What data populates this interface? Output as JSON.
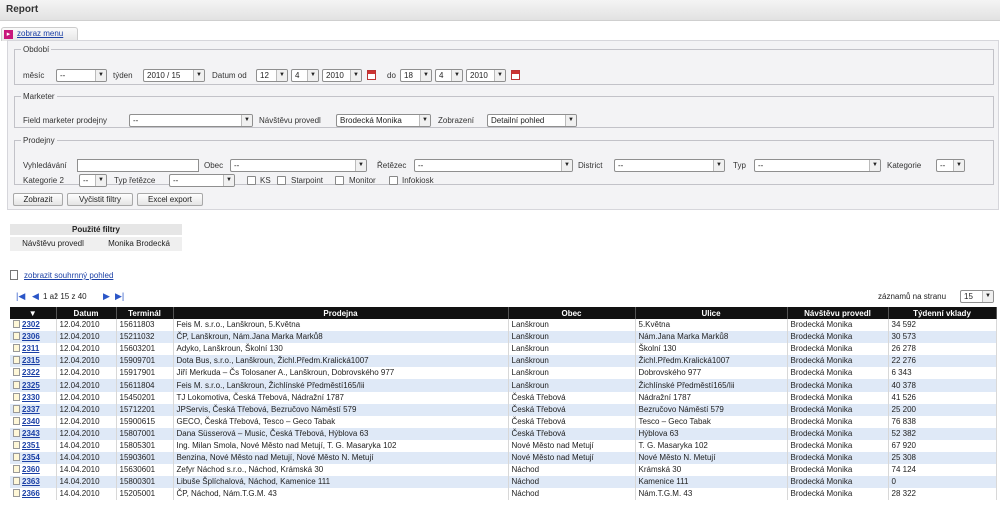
{
  "window": {
    "title": "Report"
  },
  "menu": {
    "toggle_label": "zobraz menu"
  },
  "obdobi": {
    "legend": "Období",
    "mesic_label": "měsíc",
    "mesic_value": "--",
    "tyden_label": "týden",
    "tyden_value": "2010 / 15",
    "datum_od_label": "Datum od",
    "od_day": "12",
    "od_month": "4",
    "od_year": "2010",
    "do_label": "do",
    "do_day": "18",
    "do_month": "4",
    "do_year": "2010"
  },
  "marketer": {
    "legend": "Marketer",
    "field_marketer_label": "Field marketer prodejny",
    "field_marketer_value": "--",
    "navstevu_label": "Návštěvu provedl",
    "navstevu_value": "Brodecká Monika",
    "zobrazeni_label": "Zobrazení",
    "zobrazeni_value": "Detailní pohled"
  },
  "prodejny": {
    "legend": "Prodejny",
    "vyhledavani_label": "Vyhledávání",
    "vyhledavani_value": "",
    "obec_label": "Obec",
    "obec_value": "--",
    "retezec_label": "Řetězec",
    "retezec_value": "--",
    "district_label": "District",
    "district_value": "--",
    "typ_label": "Typ",
    "typ_value": "--",
    "kategorie_label": "Kategorie",
    "kategorie_value": "--",
    "kategorie2_label": "Kategorie 2",
    "kategorie2_value": "--",
    "typ_retezce_label": "Typ řetězce",
    "typ_retezce_value": "--",
    "checkboxes": [
      "KS",
      "Starpoint",
      "Monitor",
      "Infokiosk"
    ]
  },
  "buttons": {
    "zobrazit": "Zobrazit",
    "vycistit": "Vyčistit filtry",
    "excel": "Excel export"
  },
  "used_filters": {
    "title": "Použité filtry",
    "key": "Návštěvu provedl",
    "value": "Monika Brodecká"
  },
  "summary_link": "zobrazit souhrnný pohled",
  "pager": {
    "text": "1 až 15 z 40",
    "per_page_label": "záznamů na stranu",
    "per_page_value": "15"
  },
  "table": {
    "headers": [
      "▼",
      "Datum",
      "Terminál",
      "Prodejna",
      "Obec",
      "Ulice",
      "Návštěvu provedl",
      "Týdenní vklady"
    ],
    "rows": [
      [
        "2302",
        "12.04.2010",
        "15611803",
        "Feis M. s.r.o., Lanškroun, 5.Května",
        "Lanškroun",
        "5.Května",
        "Brodecká Monika",
        "34 592"
      ],
      [
        "2306",
        "12.04.2010",
        "15211032",
        "ČP, Lanškroun, Nám.Jana Marka Marků8",
        "Lanškroun",
        "Nám.Jana Marka Marků8",
        "Brodecká Monika",
        "30 573"
      ],
      [
        "2311",
        "12.04.2010",
        "15603201",
        "Adyko, Lanškroun, Školní 130",
        "Lanškroun",
        "Školní 130",
        "Brodecká Monika",
        "26 278"
      ],
      [
        "2315",
        "12.04.2010",
        "15909701",
        "Dota Bus, s.r.o., Lanškroun, Žichl.Předm.Kralická1007",
        "Lanškroun",
        "Žichl.Předm.Kralická1007",
        "Brodecká Monika",
        "22 276"
      ],
      [
        "2322",
        "12.04.2010",
        "15917901",
        "Jiří Merkuda – Čs Tolosaner A., Lanškroun, Dobrovského 977",
        "Lanškroun",
        "Dobrovského 977",
        "Brodecká Monika",
        "6 343"
      ],
      [
        "2325",
        "12.04.2010",
        "15611804",
        "Feis M. s.r.o., Lanškroun, Žichlínské Předměstí165/Iii",
        "Lanškroun",
        "Žichlínské Předměstí165/Iii",
        "Brodecká Monika",
        "40 378"
      ],
      [
        "2330",
        "12.04.2010",
        "15450201",
        "TJ Lokomotiva, Česká Třebová, Nádražní 1787",
        "Česká Třebová",
        "Nádražní 1787",
        "Brodecká Monika",
        "41 526"
      ],
      [
        "2337",
        "12.04.2010",
        "15712201",
        "JPServis, Česká Třebová, Bezručovo Náměstí 579",
        "Česká Třebová",
        "Bezručovo Náměstí 579",
        "Brodecká Monika",
        "25 200"
      ],
      [
        "2340",
        "12.04.2010",
        "15900615",
        "GECO, Česká Třebová, Tesco – Geco Tabak",
        "Česká Třebová",
        "Tesco – Geco Tabak",
        "Brodecká Monika",
        "76 838"
      ],
      [
        "2343",
        "12.04.2010",
        "15807001",
        "Dana Süsserová – Music, Česká Třebová, Hýblova 63",
        "Česká Třebová",
        "Hýblova 63",
        "Brodecká Monika",
        "52 382"
      ],
      [
        "2351",
        "14.04.2010",
        "15805301",
        "Ing. Milan Smola, Nové Město nad Metují, T. G. Masaryka 102",
        "Nové Město nad Metují",
        "T. G. Masaryka 102",
        "Brodecká Monika",
        "67 920"
      ],
      [
        "2354",
        "14.04.2010",
        "15903601",
        "Benzina, Nové Město nad Metují, Nové Město N. Metují",
        "Nové Město nad Metují",
        "Nové Město N. Metují",
        "Brodecká Monika",
        "25 308"
      ],
      [
        "2360",
        "14.04.2010",
        "15630601",
        "Zefyr Náchod s.r.o., Náchod, Krámská 30",
        "Náchod",
        "Krámská 30",
        "Brodecká Monika",
        "74 124"
      ],
      [
        "2363",
        "14.04.2010",
        "15800301",
        "Libuše Šplíchalová, Náchod, Kamenice 111",
        "Náchod",
        "Kamenice 111",
        "Brodecká Monika",
        "0"
      ],
      [
        "2366",
        "14.04.2010",
        "15205001",
        "ČP, Náchod, Nám.T.G.M. 43",
        "Náchod",
        "Nám.T.G.M. 43",
        "Brodecká Monika",
        "28 322"
      ]
    ]
  }
}
